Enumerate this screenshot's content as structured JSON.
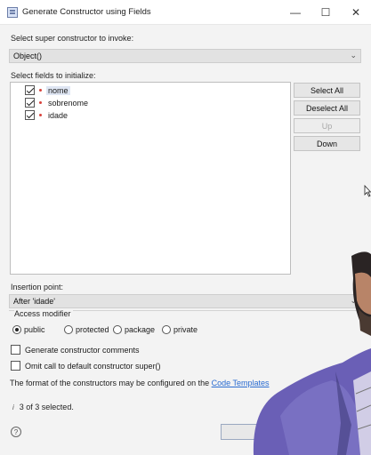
{
  "window": {
    "title": "Generate Constructor using Fields",
    "controls": [
      "—",
      "☐",
      "✕"
    ]
  },
  "super_constructor": {
    "label": "Select super constructor to invoke:",
    "value": "Object()"
  },
  "fields": {
    "label": "Select fields to initialize:",
    "items": [
      {
        "name": "nome",
        "checked": true,
        "selected": true
      },
      {
        "name": "sobrenome",
        "checked": true,
        "selected": false
      },
      {
        "name": "idade",
        "checked": true,
        "selected": false
      }
    ]
  },
  "buttons": {
    "select_all": "Select All",
    "deselect_all": "Deselect All",
    "up": "Up",
    "down": "Down"
  },
  "insertion_point": {
    "label": "Insertion point:",
    "value": "After 'idade'"
  },
  "access_modifier": {
    "label": "Access modifier",
    "options": [
      "public",
      "protected",
      "package",
      "private"
    ],
    "selected": "public"
  },
  "options": {
    "generate_comments": "Generate constructor comments",
    "omit_super": "Omit call to default constructor super()"
  },
  "info_text": {
    "prefix": "The format of the constructors may be configured on the ",
    "link": "Code Templates"
  },
  "selection_status": "3 of 3 selected.",
  "colors": {
    "link": "#2a6cd1",
    "field_marker": "#d8423c",
    "selection": "#dfe6f3"
  }
}
